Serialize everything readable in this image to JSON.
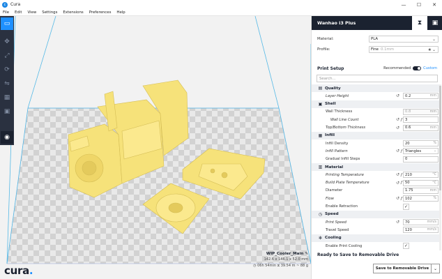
{
  "window": {
    "title": "Cura",
    "logo_glyph": "c",
    "minimize": "—",
    "maximize": "☐",
    "close": "✕"
  },
  "menu": [
    "File",
    "Edit",
    "View",
    "Settings",
    "Extensions",
    "Preferences",
    "Help"
  ],
  "brand": {
    "name": "cura",
    "dot": "."
  },
  "job": {
    "name": "WIP_Cooler_Main",
    "dimensions": "142.6 x 146.1 x 52.0 mm",
    "estimate": "◷ 06h 54min  ⧖ 39.54 m ~ 88 g",
    "edit_icon": "✎"
  },
  "sidebar": {
    "printer_name": "Wanhao i3 Plus",
    "material_label": "Material:",
    "material_value": "PLA",
    "profile_label": "Profile:",
    "profile_value": "Fine",
    "profile_sub": "0.1mm",
    "profile_star": "★",
    "print_setup_title": "Print Setup",
    "mode_recommended": "Recommended",
    "mode_custom": "Custom",
    "search_placeholder": "Search...",
    "ready_text": "Ready to Save to Removable Drive",
    "save_button": "Save to Removable Drive",
    "caret": "⌄"
  },
  "settings": [
    {
      "kind": "cat",
      "icon": "▤",
      "label": "Quality"
    },
    {
      "kind": "setting",
      "label": "Layer Height",
      "italic": true,
      "reset": true,
      "value": "0.2",
      "unit": "mm"
    },
    {
      "kind": "cat",
      "icon": "▣",
      "label": "Shell"
    },
    {
      "kind": "setting",
      "label": "Wall Thickness",
      "disabled": true,
      "value": "0.8",
      "unit": "mm"
    },
    {
      "kind": "setting",
      "label": "Wall Line Count",
      "italic": true,
      "indent": true,
      "reset": true,
      "fx": true,
      "value": "3",
      "unit": ""
    },
    {
      "kind": "setting",
      "label": "Top/Bottom Thickness",
      "italic": true,
      "reset": true,
      "value": "0.6",
      "unit": "mm"
    },
    {
      "kind": "cat",
      "icon": "▦",
      "label": "Infill"
    },
    {
      "kind": "setting",
      "label": "Infill Density",
      "value": "20",
      "unit": "%"
    },
    {
      "kind": "setting",
      "label": "Infill Pattern",
      "italic": true,
      "reset": true,
      "fx": true,
      "value": "Triangles",
      "unit": "⌄"
    },
    {
      "kind": "setting",
      "label": "Gradual Infill Steps",
      "value": "0",
      "unit": ""
    },
    {
      "kind": "cat",
      "icon": "▥",
      "label": "Material"
    },
    {
      "kind": "setting",
      "label": "Printing Temperature",
      "italic": true,
      "reset": true,
      "fx": true,
      "value": "210",
      "unit": "°C"
    },
    {
      "kind": "setting",
      "label": "Build Plate Temperature",
      "italic": true,
      "reset": true,
      "fx": true,
      "value": "50",
      "unit": "°C"
    },
    {
      "kind": "setting",
      "label": "Diameter",
      "value": "1.75",
      "unit": "mm"
    },
    {
      "kind": "setting",
      "label": "Flow",
      "italic": true,
      "reset": true,
      "fx": true,
      "value": "102",
      "unit": "%"
    },
    {
      "kind": "checkbox",
      "label": "Enable Retraction",
      "checked": true
    },
    {
      "kind": "cat",
      "icon": "◷",
      "label": "Speed"
    },
    {
      "kind": "setting",
      "label": "Print Speed",
      "italic": true,
      "reset": true,
      "value": "70",
      "unit": "mm/s"
    },
    {
      "kind": "setting",
      "label": "Travel Speed",
      "value": "120",
      "unit": "mm/s"
    },
    {
      "kind": "cat",
      "icon": "✻",
      "label": "Cooling"
    },
    {
      "kind": "checkbox",
      "label": "Enable Print Cooling",
      "checked": true
    }
  ],
  "reset_icon": "↺",
  "fx_icon": "ƒ",
  "check_glyph": "✓",
  "colors": {
    "accent": "#1e90ff",
    "header": "#1b2230",
    "model": "#f6e27a",
    "model_shadow": "#d9c45a",
    "volume": "#55b9e6"
  },
  "icons": [
    "open-file-icon",
    "translate-icon",
    "scale-icon",
    "rotate-icon",
    "mirror-icon",
    "per-model-settings-icon",
    "support-blocker-icon",
    "view-mode-icon"
  ]
}
